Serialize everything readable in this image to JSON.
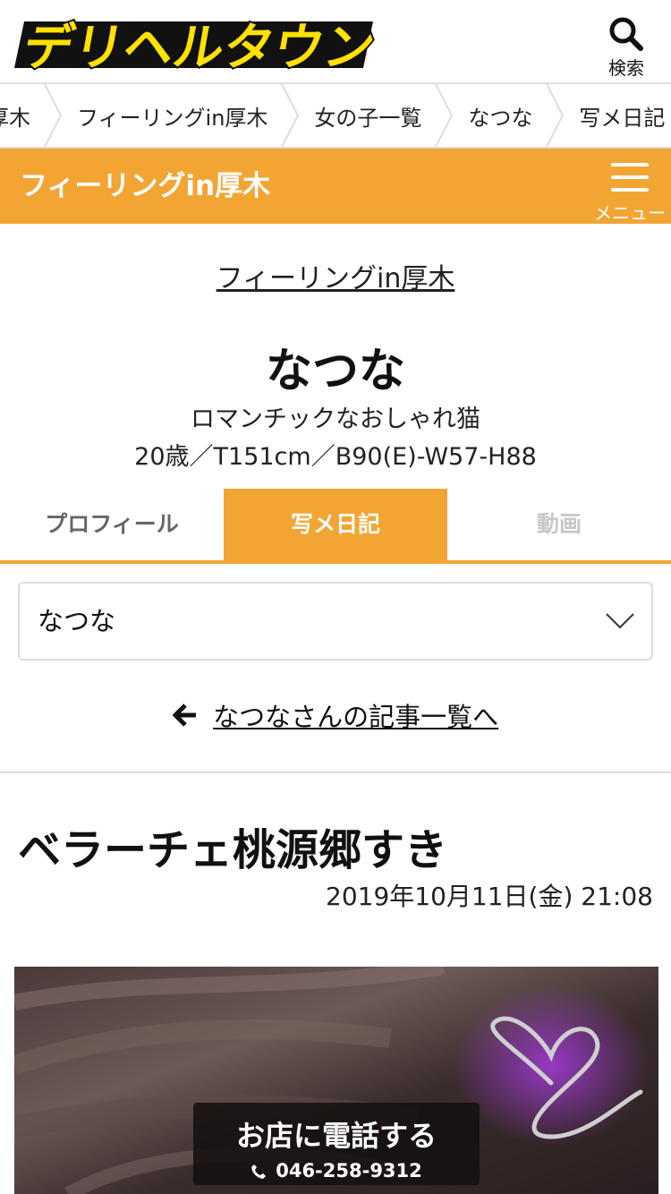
{
  "header": {
    "logo_text": "デリヘルタウン",
    "search_label": "検索"
  },
  "breadcrumb": {
    "items": [
      "厚木",
      "フィーリングin厚木",
      "女の子一覧",
      "なつな",
      "写メ日記"
    ]
  },
  "shopbar": {
    "title": "フィーリングin厚木",
    "menu_label": "メニュー"
  },
  "profile": {
    "shop_link": "フィーリングin厚木",
    "name": "なつな",
    "catchphrase": "ロマンチックなおしゃれ猫",
    "specs": "20歳／T151cm／B90(E)-W57-H88"
  },
  "tabs": [
    {
      "label": "プロフィール",
      "active": false
    },
    {
      "label": "写メ日記",
      "active": true
    },
    {
      "label": "動画",
      "active": false
    }
  ],
  "girl_select": {
    "value": "なつな"
  },
  "back_link": "なつなさんの記事一覧へ",
  "article": {
    "title": "ベラーチェ桃源郷すき",
    "date": "2019年10月11日(金) 21:08"
  },
  "call_button": {
    "label": "お店に電話する",
    "phone": "046-258-9312"
  },
  "colors": {
    "accent": "#f3a534",
    "logo_yellow": "#ffe100",
    "border": "#dddddd"
  }
}
